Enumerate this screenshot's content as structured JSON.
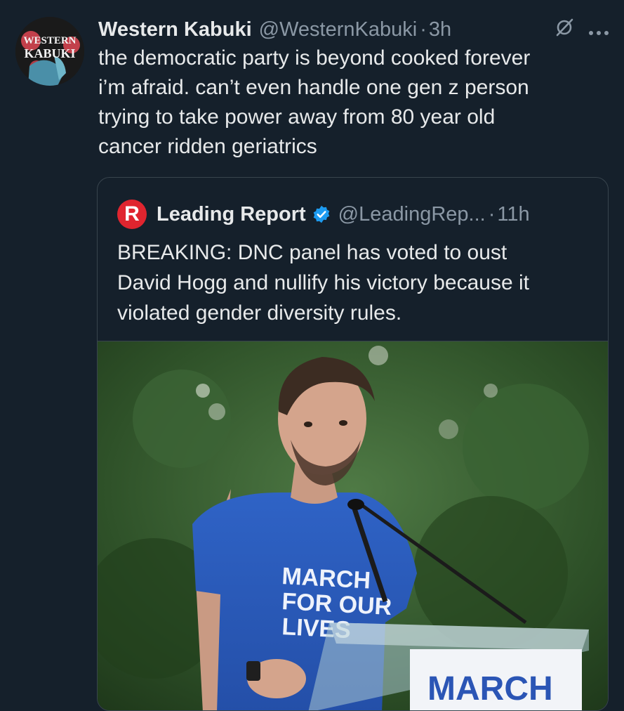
{
  "tweet": {
    "avatar_icon": "western-kabuki-avatar-icon",
    "avatar_text": "WESTERN KABUKI",
    "author_name": "Western Kabuki",
    "author_handle": "@WesternKabuki",
    "separator": "·",
    "time": "3h",
    "text": "the democratic party is beyond cooked forever\ni’m afraid.  can’t even handle one gen z person\ntrying to take power away from 80 year old\ncancer ridden geriatrics",
    "icons": [
      "grok-icon",
      "more-icon"
    ]
  },
  "quoted_tweet": {
    "logo_letter": "R",
    "author_name": "Leading Report",
    "verified_icon": "verified-badge-icon",
    "author_handle": "@LeadingRep...",
    "separator": "·",
    "time": "11h",
    "text": "BREAKING: DNC panel has voted to oust\nDavid Hogg and nullify his victory because it\nviolated gender diversity rules.",
    "photo": {
      "description_icon": "photo-speaker-at-podium",
      "shirt_lines": [
        "MARCH",
        "FOR OUR",
        "LIVES"
      ],
      "podium_sign_text": "MARCH"
    }
  },
  "colors": {
    "background": "#15202b",
    "text": "#e7e9ea",
    "secondary": "#8b98a5",
    "border": "#38444d",
    "verified": "#1d9bf0",
    "brand_red": "#e0252f"
  }
}
